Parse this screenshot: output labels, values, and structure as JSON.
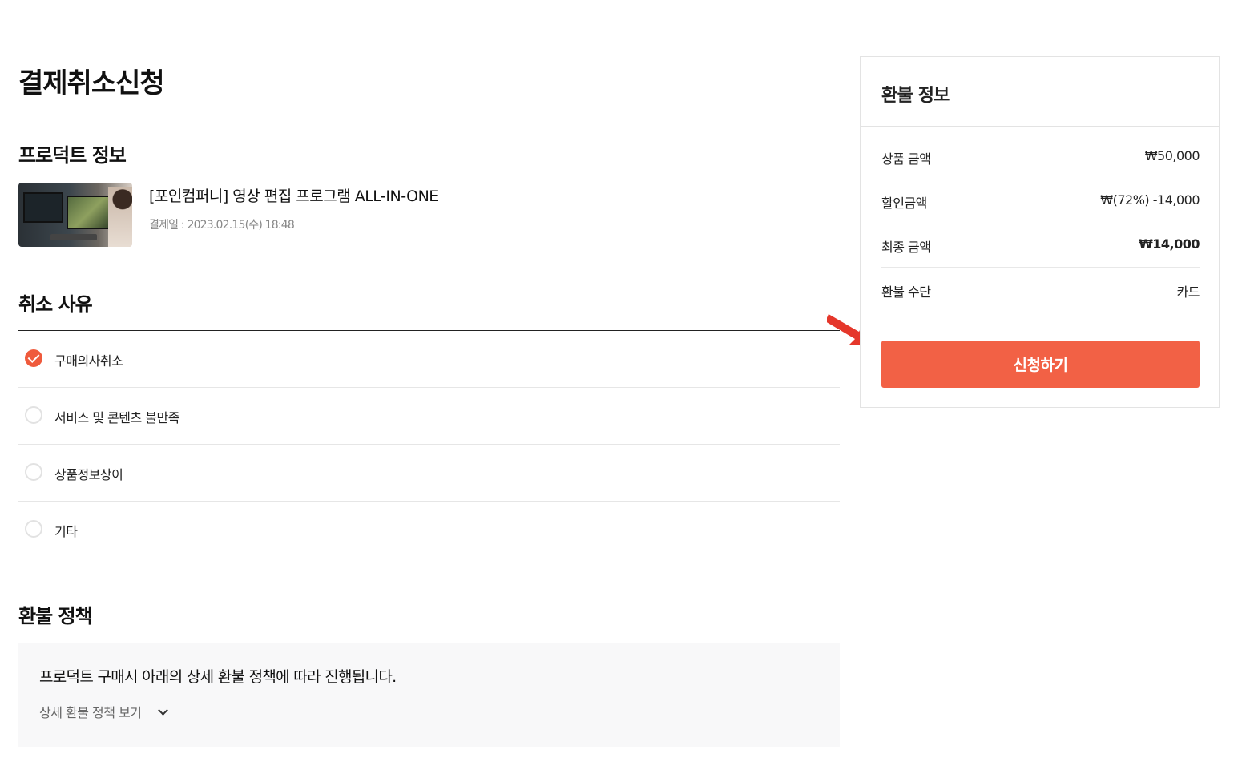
{
  "page": {
    "title": "결제취소신청"
  },
  "product_section": {
    "title": "프로덕트 정보",
    "product_title": "[포인컴퍼니] 영상 편집 프로그램 ALL-IN-ONE",
    "paid_date": "결제일 : 2023.02.15(수) 18:48"
  },
  "reason_section": {
    "title": "취소 사유",
    "options": [
      {
        "label": "구매의사취소",
        "selected": true
      },
      {
        "label": "서비스 및 콘텐츠 불만족",
        "selected": false
      },
      {
        "label": "상품정보상이",
        "selected": false
      },
      {
        "label": "기타",
        "selected": false
      }
    ]
  },
  "policy_section": {
    "title": "환불 정책",
    "description": "프로덕트 구매시 아래의 상세 환불 정책에 따라 진행됩니다.",
    "detail_link": "상세 환불 정책 보기"
  },
  "refund_panel": {
    "title": "환불 정보",
    "rows": [
      {
        "label": "상품 금액",
        "value": "₩50,000"
      },
      {
        "label": "할인금액",
        "value": "₩(72%) -14,000"
      },
      {
        "label": "최종 금액",
        "value": "₩14,000"
      },
      {
        "label": "환불 수단",
        "value": "카드"
      }
    ],
    "submit_label": "신청하기"
  },
  "colors": {
    "accent": "#f26145",
    "check": "#ef5a3c",
    "annotation_arrow": "#e5372b"
  }
}
